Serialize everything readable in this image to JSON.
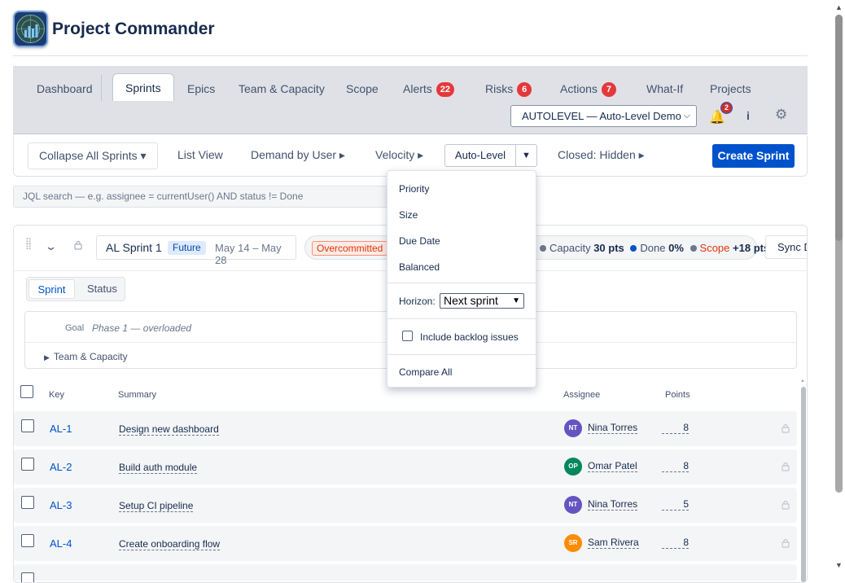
{
  "app": {
    "title": "Project Commander"
  },
  "nav": {
    "tabs": [
      {
        "label": "Dashboard"
      },
      {
        "label": "Sprints"
      },
      {
        "label": "Epics"
      },
      {
        "label": "Team & Capacity"
      },
      {
        "label": "Scope"
      },
      {
        "label": "Alerts",
        "badge": "22"
      },
      {
        "label": "Risks",
        "badge": "6"
      },
      {
        "label": "Actions",
        "badge": "7"
      },
      {
        "label": "What-If"
      },
      {
        "label": "Projects"
      }
    ],
    "active_tab": "Sprints",
    "project_select": {
      "value": "AUTOLEVEL — Auto-Level Demo"
    },
    "notifications_count": "2",
    "info_icon": "i",
    "gear_icon": "⚙"
  },
  "toolbar": {
    "collapse_label": "Collapse All Sprints ▾",
    "list_view": "List View",
    "demand_by_user": "Demand by User ▸",
    "velocity": "Velocity ▸",
    "auto_level": "Auto-Level",
    "auto_level_caret": "▼",
    "closed": "Closed: Hidden ▸",
    "create_sprint": "Create Sprint"
  },
  "search": {
    "placeholder": "JQL search — e.g. assignee = currentUser() AND status != Done"
  },
  "auto_level_menu": {
    "sort_options": [
      "Priority",
      "Size",
      "Due Date",
      "Balanced"
    ],
    "horizon_label": "Horizon:",
    "horizon_value": "Next sprint",
    "include_backlog_label": "Include backlog issues",
    "compare_all": "Compare All"
  },
  "sprint": {
    "name": "AL Sprint 1",
    "state": "Future",
    "dates": "May 14 – May 28",
    "overcommitted": "Overcommitted",
    "capacity_label": "Capacity",
    "capacity_value": "30 pts",
    "done_label": "Done",
    "done_value": "0%",
    "scope_label": "Scope",
    "scope_value": "+18 pts",
    "sync_button": "Sync D",
    "view_tabs": [
      "Sprint",
      "Status"
    ],
    "goal_label": "Goal",
    "goal_text": "Phase 1 — overloaded",
    "team_capacity_label": "Team & Capacity",
    "colors": {
      "capacity_dot": "#6b778c",
      "done_dot": "#0052cc",
      "scope_dot": "#6b778c",
      "scope_text": "#de350b"
    }
  },
  "table": {
    "headers": {
      "key": "Key",
      "summary": "Summary",
      "assignee": "Assignee",
      "points": "Points"
    },
    "rows": [
      {
        "key": "AL-1",
        "summary": "Design new dashboard",
        "initials": "NT",
        "assignee": "Nina Torres",
        "points": "8",
        "avatar_color": "#6554c0"
      },
      {
        "key": "AL-2",
        "summary": "Build auth module",
        "initials": "OP",
        "assignee": "Omar Patel",
        "points": "8",
        "avatar_color": "#00875a"
      },
      {
        "key": "AL-3",
        "summary": "Setup CI pipeline",
        "initials": "NT",
        "assignee": "Nina Torres",
        "points": "5",
        "avatar_color": "#6554c0"
      },
      {
        "key": "AL-4",
        "summary": "Create onboarding flow",
        "initials": "SR",
        "assignee": "Sam Rivera",
        "points": "8",
        "avatar_color": "#ff8b00"
      }
    ]
  }
}
